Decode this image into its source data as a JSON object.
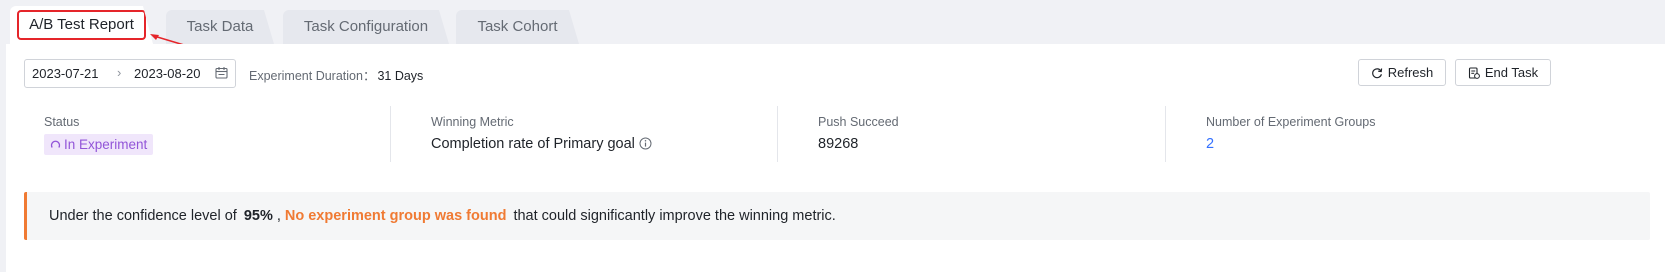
{
  "tabs": [
    {
      "label": "A/B Test Report",
      "active": true
    },
    {
      "label": "Task Data",
      "active": false
    },
    {
      "label": "Task Configuration",
      "active": false
    },
    {
      "label": "Task Cohort",
      "active": false
    }
  ],
  "toolbar": {
    "date_from": "2023-07-21",
    "date_to": "2023-08-20",
    "duration_label": "Experiment Duration：",
    "duration_value": "31 Days",
    "refresh_label": "Refresh",
    "end_task_label": "End Task"
  },
  "stats": {
    "status": {
      "label": "Status",
      "value": "In Experiment"
    },
    "winning_metric": {
      "label": "Winning Metric",
      "value": "Completion rate of Primary goal"
    },
    "push_succeed": {
      "label": "Push Succeed",
      "value": "89268"
    },
    "groups": {
      "label": "Number of Experiment Groups",
      "value": "2"
    }
  },
  "notice": {
    "prefix": "Under the confidence level of",
    "confidence": "95%",
    "comma": ",",
    "highlight": "No experiment group was found",
    "suffix": "that could significantly improve the winning metric."
  },
  "colors": {
    "accent": "#3370ff",
    "warning": "#f07a33",
    "status_badge_bg": "#f0e6fb",
    "status_badge_text": "#9255d8",
    "annotation_red": "#e5252a"
  },
  "icons": {
    "calendar": "calendar-icon",
    "refresh": "refresh-icon",
    "end_task": "end-task-icon",
    "info": "info-icon",
    "loading": "loading-icon"
  }
}
